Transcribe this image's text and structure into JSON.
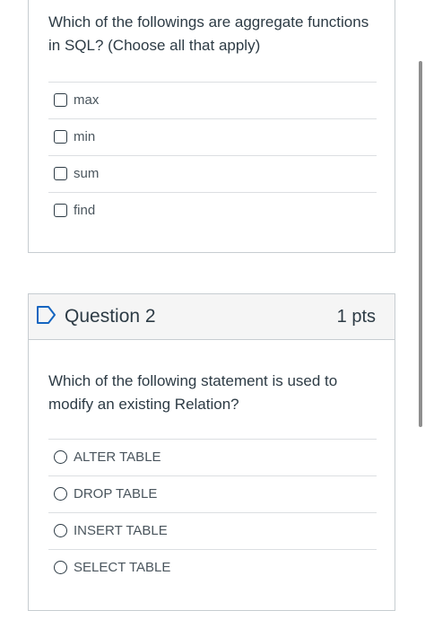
{
  "question1": {
    "text": "Which of the followings are aggregate functions in SQL? (Choose all that apply)",
    "options": [
      {
        "label": "max"
      },
      {
        "label": "min"
      },
      {
        "label": "sum"
      },
      {
        "label": "find"
      }
    ]
  },
  "question2": {
    "title": "Question 2",
    "points": "1 pts",
    "flag_icon": "flag-outline-icon",
    "text": "Which of the following statement is used to modify an existing Relation?",
    "options": [
      {
        "label": "ALTER TABLE"
      },
      {
        "label": "DROP TABLE"
      },
      {
        "label": "INSERT TABLE"
      },
      {
        "label": "SELECT TABLE"
      }
    ]
  },
  "colors": {
    "text": "#2d3b45",
    "border": "#c7cdd1",
    "header_bg": "#f5f5f5",
    "flag": "#1565c0"
  }
}
